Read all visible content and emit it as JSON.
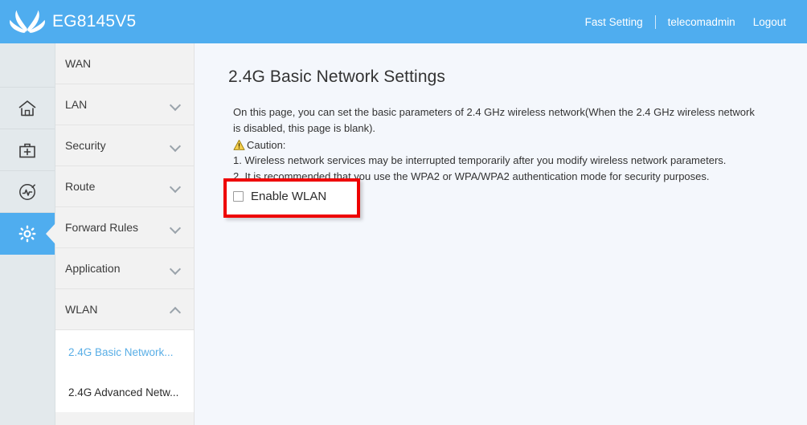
{
  "header": {
    "brand": "EG8145V5",
    "logo_icon": "huawei-flower-logo",
    "fast_setting": "Fast Setting",
    "user": "telecomadmin",
    "logout": "Logout"
  },
  "iconbar": {
    "items": [
      {
        "icon": "home-icon",
        "name": "home"
      },
      {
        "icon": "toolbox-icon",
        "name": "maintenance"
      },
      {
        "icon": "diagnosis-gauge-icon",
        "name": "diagnosis"
      },
      {
        "icon": "gear-icon",
        "name": "settings",
        "active": true
      }
    ]
  },
  "menu": {
    "items": [
      {
        "label": "WAN",
        "chevron": "none"
      },
      {
        "label": "LAN",
        "chevron": "down"
      },
      {
        "label": "Security",
        "chevron": "down"
      },
      {
        "label": "Route",
        "chevron": "down"
      },
      {
        "label": "Forward Rules",
        "chevron": "down"
      },
      {
        "label": "Application",
        "chevron": "down"
      },
      {
        "label": "WLAN",
        "chevron": "up"
      }
    ],
    "submenu": [
      {
        "label": "2.4G Basic Network...",
        "active": true
      },
      {
        "label": "2.4G Advanced Netw...",
        "active": false
      }
    ]
  },
  "main": {
    "title": "2.4G Basic Network Settings",
    "description_line1": "On this page, you can set the basic parameters of 2.4 GHz wireless network(When the 2.4 GHz wireless network is disabled, this page is blank).",
    "caution_icon": "warning-triangle-icon",
    "caution_label": "Caution:",
    "caution_items": [
      "1. Wireless network services may be interrupted temporarily after you modify wireless network parameters.",
      "2. It is recommended that you use the WPA2 or WPA/WPA2 authentication mode for security purposes."
    ],
    "enable_wlan_label": "Enable WLAN",
    "enable_wlan_checked": false
  },
  "colors": {
    "header_blue": "#4fadef",
    "accent_blue": "#59aee6",
    "highlight_red": "#ee0000",
    "content_bg": "#f4f7fc",
    "menu_bg": "#f2f2f2",
    "iconbar_bg": "#e3e9ec",
    "caution_yellow": "#f2c94c"
  }
}
